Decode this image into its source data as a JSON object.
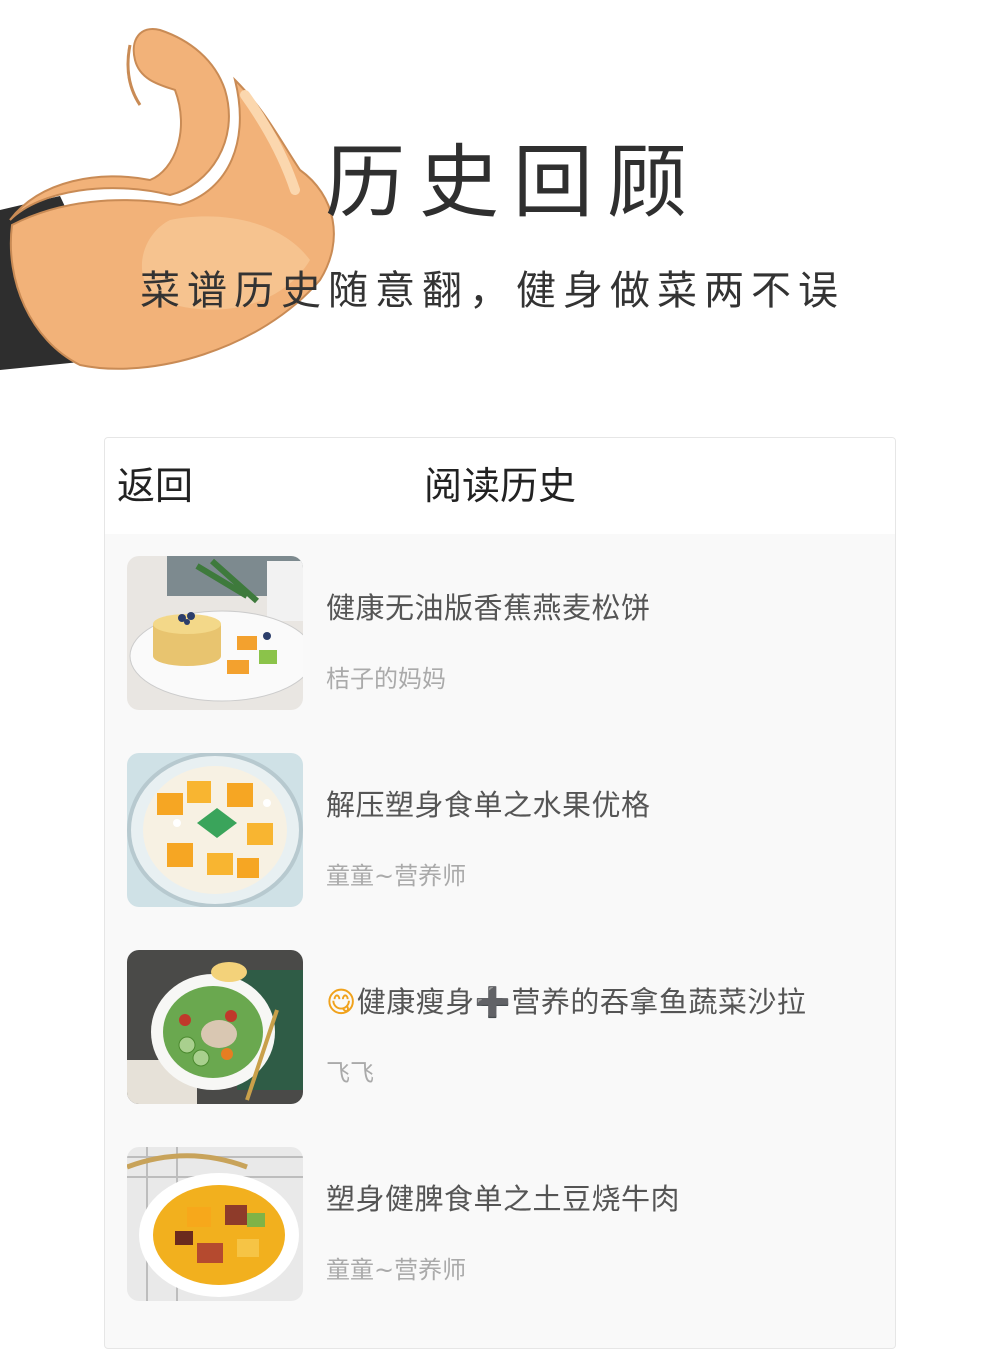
{
  "hero": {
    "title": "历史回顾",
    "subtitle": "菜谱历史随意翻，健身做菜两不误",
    "illustration": "flexed-arm-icon"
  },
  "navbar": {
    "back_label": "返回",
    "title": "阅读历史"
  },
  "history": [
    {
      "title": "健康无油版香蕉燕麦松饼",
      "author": "桔子的妈妈",
      "thumb": "pancake-stack-photo"
    },
    {
      "title": "解压塑身食单之水果优格",
      "author": "童童~营养师",
      "thumb": "mango-yogurt-bowl-photo"
    },
    {
      "title_emoji": "😋",
      "title": "健康瘦身➕营养的吞拿鱼蔬菜沙拉",
      "author": "飞飞",
      "thumb": "tuna-salad-plate-photo"
    },
    {
      "title": "塑身健脾食单之土豆烧牛肉",
      "author": "童童~营养师",
      "thumb": "potato-beef-stew-photo"
    }
  ],
  "colors": {
    "panel_bg": "#f9f9f9",
    "title": "#2f2f2f",
    "author": "#aaaaaa",
    "skin": "#f2b279"
  }
}
